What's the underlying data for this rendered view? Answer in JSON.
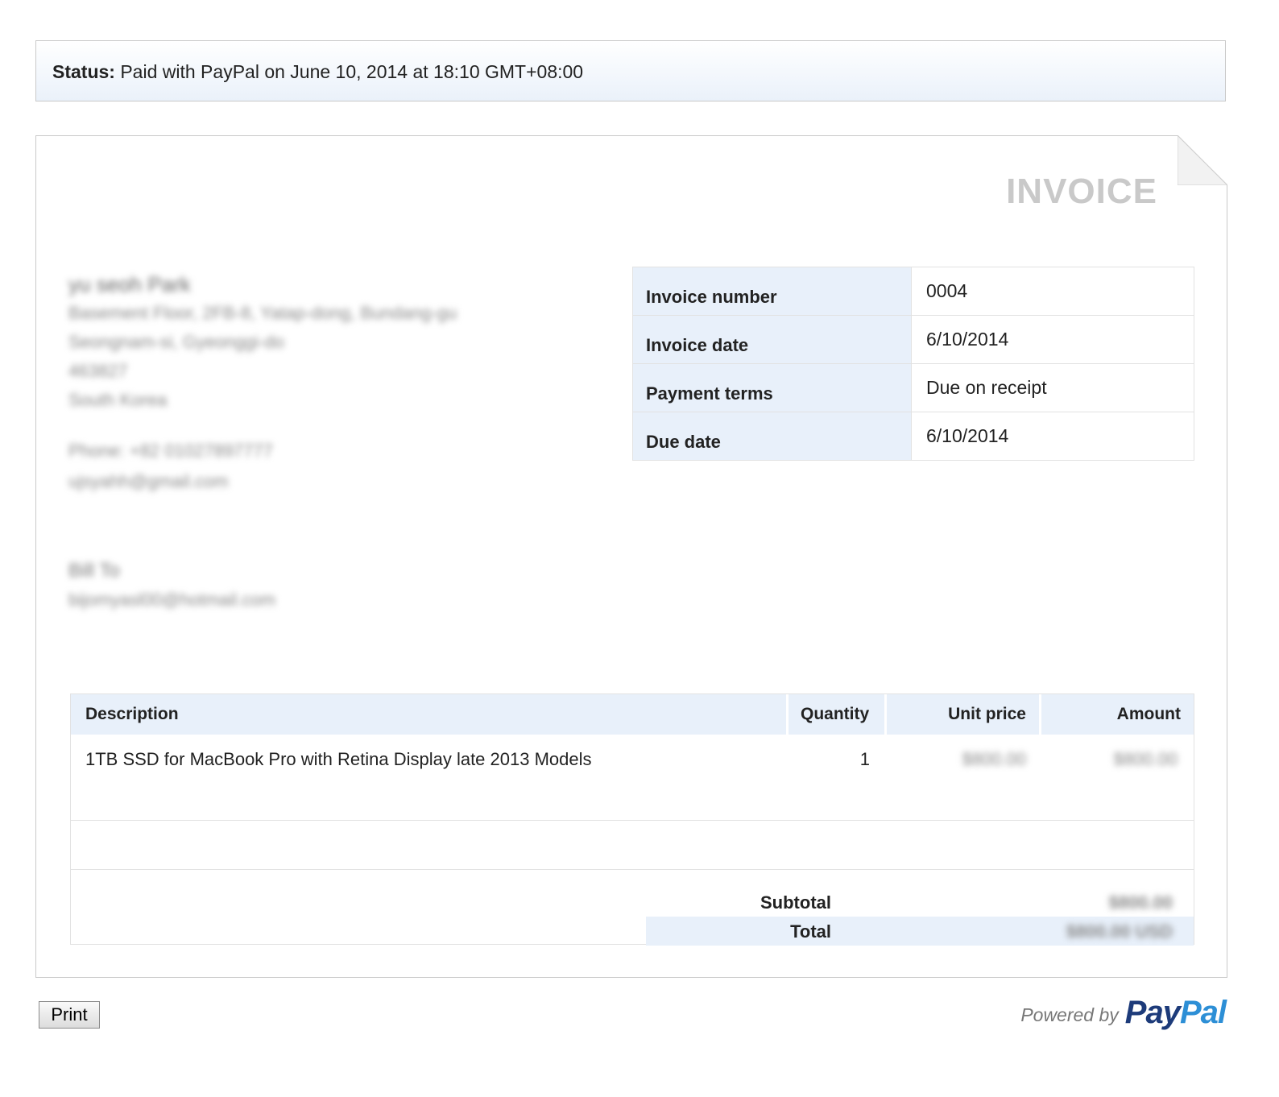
{
  "status": {
    "label": "Status:",
    "text": "Paid with PayPal on June 10, 2014 at 18:10 GMT+08:00"
  },
  "invoice": {
    "title": "INVOICE",
    "sender": {
      "name": "yu seoh Park",
      "address_line1": "Basement Floor, 2FB-8, Yatap-dong, Bundang-gu",
      "address_line2": "Seongnam-si, Gyeonggi-do",
      "postal": "463827",
      "country": "South Korea",
      "phone": "Phone: +82 01027897777",
      "email": "ujsyahh@gmail.com"
    },
    "bill_to": {
      "label": "Bill To",
      "email": "bijomyasl00@hotmail.com"
    },
    "meta": [
      {
        "label": "Invoice number",
        "value": "0004"
      },
      {
        "label": "Invoice date",
        "value": "6/10/2014"
      },
      {
        "label": "Payment terms",
        "value": "Due on receipt"
      },
      {
        "label": "Due date",
        "value": "6/10/2014"
      }
    ],
    "items_header": {
      "description": "Description",
      "quantity": "Quantity",
      "unit_price": "Unit price",
      "amount": "Amount"
    },
    "items": [
      {
        "description": "1TB SSD for MacBook Pro with Retina Display late 2013 Models",
        "quantity": "1",
        "unit_price": "$800.00",
        "amount": "$800.00"
      }
    ],
    "totals": {
      "subtotal_label": "Subtotal",
      "subtotal_value": "$800.00",
      "total_label": "Total",
      "total_value": "$800.00 USD"
    }
  },
  "footer": {
    "print_label": "Print",
    "powered_by": "Powered by",
    "logo_pay": "Pay",
    "logo_pal": "Pal"
  }
}
